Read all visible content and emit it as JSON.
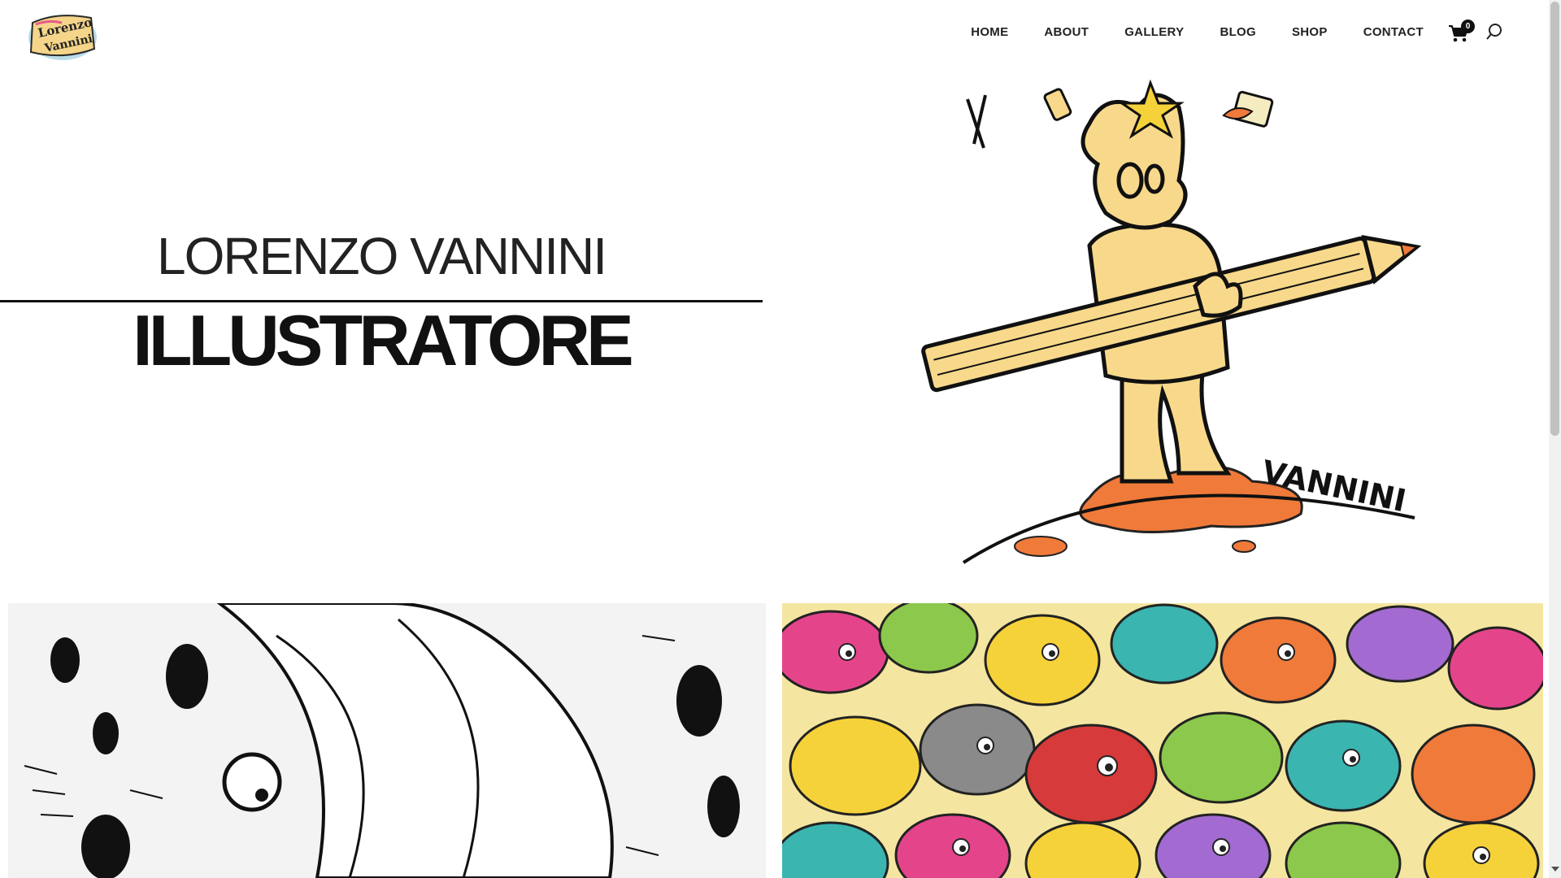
{
  "header": {
    "logo_text": "LORENZO VANNINI",
    "nav": [
      "HOME",
      "ABOUT",
      "GALLERY",
      "BLOG",
      "SHOP",
      "CONTACT"
    ],
    "cart_count": "0",
    "icons": {
      "cart": "cart-icon",
      "search": "search-icon"
    }
  },
  "hero": {
    "name": "LORENZO VANNINI",
    "role": "ILLUSTRATORE",
    "signature": "VANNINI"
  },
  "gallery": {
    "items": [
      "black-and-white-divers-illustration",
      "colorful-creatures-illustration"
    ]
  },
  "colors": {
    "text": "#111111",
    "skin": "#f8d98b",
    "splash": "#f07a3a",
    "accent_pink": "#e4458a",
    "accent_teal": "#3bb5b0"
  }
}
